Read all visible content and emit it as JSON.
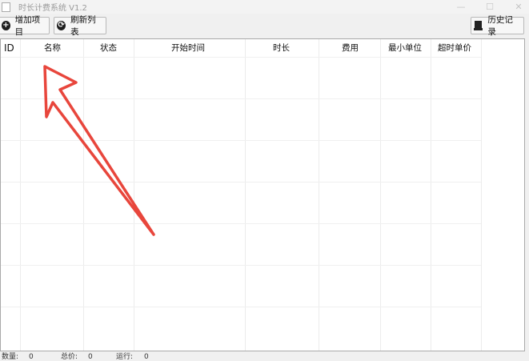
{
  "window": {
    "title": "时长计费系统 V1.2",
    "controls": [
      "—",
      "☐",
      "✕"
    ]
  },
  "toolbar": {
    "add_label": "增加项目",
    "refresh_label": "刷新列表",
    "history_label": "历史记录"
  },
  "table": {
    "columns": [
      "ID",
      "名称",
      "状态",
      "开始时间",
      "时长",
      "费用",
      "最小单位",
      "超时单价"
    ]
  },
  "statusbar": {
    "items": [
      "数量:",
      "0",
      "总价:",
      "0",
      "运行:",
      "0"
    ]
  },
  "annotation": {
    "color": "#e8463c"
  }
}
